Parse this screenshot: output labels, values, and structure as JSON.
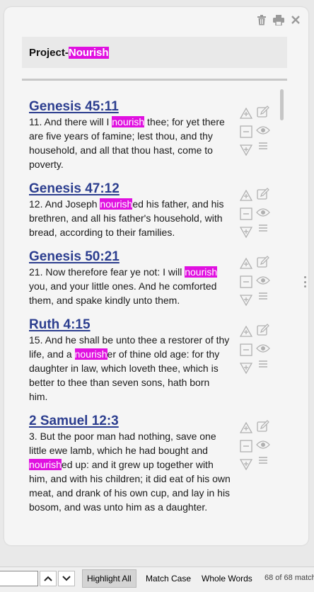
{
  "title": {
    "prefix": "Project-",
    "highlight": "Nourish"
  },
  "icons": {
    "delete": "trash-icon",
    "print": "printer-icon",
    "close": "close-icon"
  },
  "highlight_color": "#e010e0",
  "link_color": "#2c3e8f",
  "entries": [
    {
      "ref": "Genesis 45:11",
      "before": "11. And there will I ",
      "match": "nourish",
      "after": " thee; for yet there are five years of famine; lest thou, and thy household, and all that thou hast, come to poverty."
    },
    {
      "ref": "Genesis 47:12",
      "before": "12. And Joseph ",
      "match": "nourish",
      "after": "ed his father, and his brethren, and all his father's household, with bread, according to their families."
    },
    {
      "ref": "Genesis 50:21",
      "before": "21. Now therefore fear ye not: I will ",
      "match": "nourish",
      "after": " you, and your little ones. And he comforted them, and spake kindly unto them."
    },
    {
      "ref": "Ruth 4:15",
      "before": "15. And he shall be unto thee a restorer of thy life, and a ",
      "match": "nourish",
      "after": "er of thine old age: for thy daughter in law, which loveth thee, which is better to thee than seven sons, hath born him."
    },
    {
      "ref": "2 Samuel 12:3",
      "before": "3. But the poor man had nothing, save one little ewe lamb, which he had bought and ",
      "match": "nourish",
      "after": "ed up: and it grew up together with him, and with his children; it did eat of his own meat, and drank of his own cup, and lay in his bosom, and was unto him as a daughter."
    }
  ],
  "findbar": {
    "input_value": "",
    "highlight_all": "Highlight All",
    "match_case": "Match Case",
    "whole_words": "Whole Words",
    "status": "68 of 68 matches"
  }
}
